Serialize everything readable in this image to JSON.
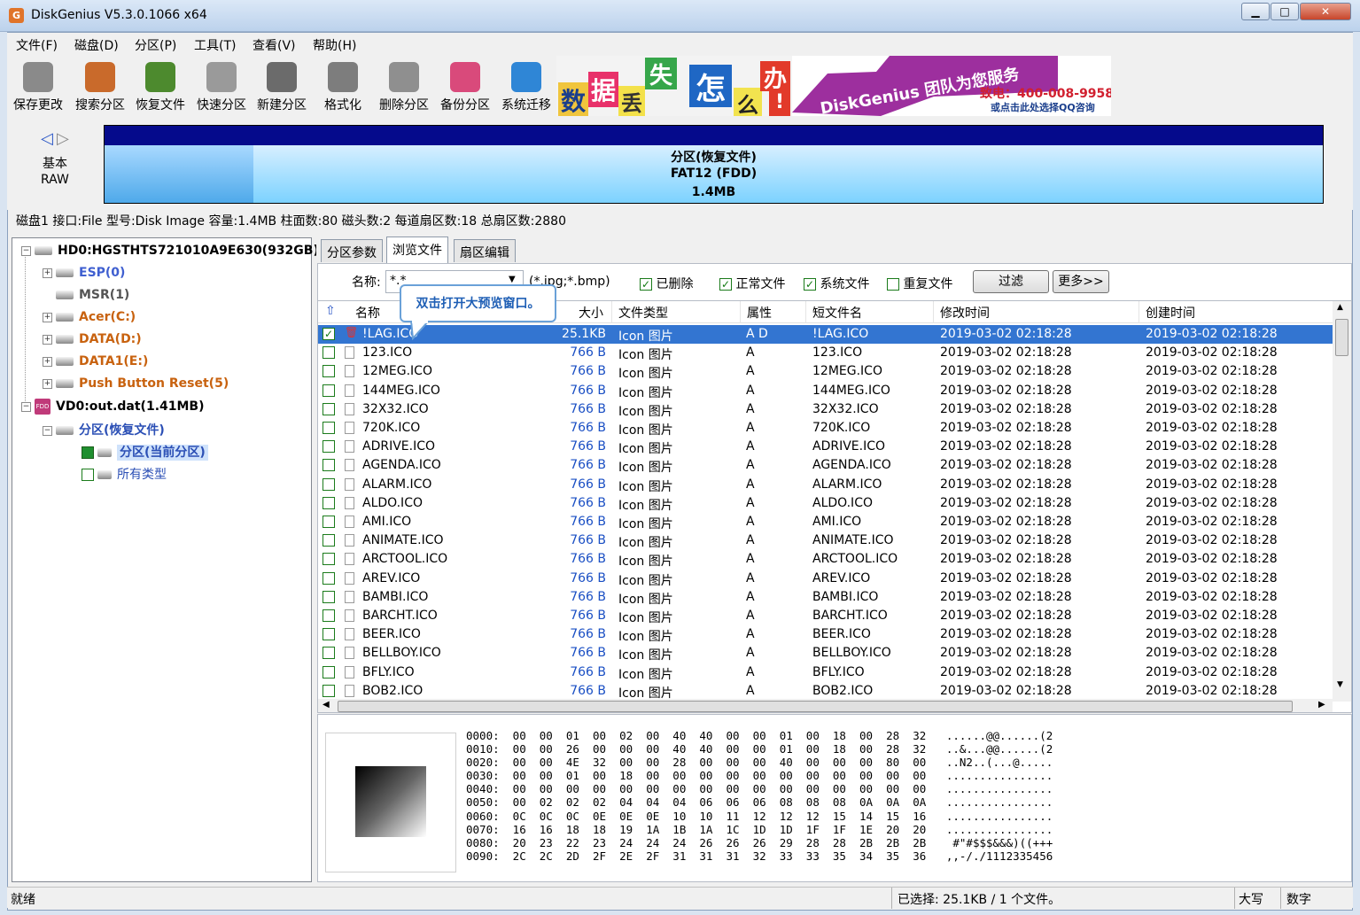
{
  "window": {
    "title": "DiskGenius V5.3.0.1066 x64",
    "icon_text": "G"
  },
  "menu": [
    "文件(F)",
    "磁盘(D)",
    "分区(P)",
    "工具(T)",
    "查看(V)",
    "帮助(H)"
  ],
  "toolbar": [
    {
      "label": "保存更改",
      "icon": "save-changes-icon",
      "color": "#8a8a8a"
    },
    {
      "label": "搜索分区",
      "icon": "search-partition-icon",
      "color": "#c96a2b"
    },
    {
      "label": "恢复文件",
      "icon": "recover-files-icon",
      "color": "#4d8a2e"
    },
    {
      "label": "快速分区",
      "icon": "quick-partition-icon",
      "color": "#9a9a9a"
    },
    {
      "label": "新建分区",
      "icon": "new-partition-icon",
      "color": "#6b6b6b"
    },
    {
      "label": "格式化",
      "icon": "format-icon",
      "color": "#7d7d7d"
    },
    {
      "label": "删除分区",
      "icon": "delete-partition-icon",
      "color": "#8f8f8f"
    },
    {
      "label": "备份分区",
      "icon": "backup-partition-icon",
      "color": "#d94a7b"
    },
    {
      "label": "系统迁移",
      "icon": "system-migration-icon",
      "color": "#2f86d6"
    }
  ],
  "banner": {
    "chars": [
      "数",
      "据",
      "丢",
      "失",
      "怎",
      "么",
      "办",
      "!"
    ],
    "slogan": "DiskGenius 团队为您服务",
    "phone": "致电：400-008-9958",
    "qq": "或点击此处选择QQ咨询"
  },
  "diskmap": {
    "disk_label": "基本",
    "disk_type": "RAW",
    "partition_name": "分区(恢复文件)",
    "partition_fs": "FAT12 (FDD)",
    "partition_size": "1.4MB"
  },
  "diskinfo": "磁盘1 接口:File  型号:Disk Image  容量:1.4MB  柱面数:80  磁头数:2  每道扇区数:18  总扇区数:2880",
  "tree": {
    "hd0": "HD0:HGSTHTS721010A9E630(932GB)",
    "hd0_parts": [
      {
        "label": "ESP(0)",
        "color": "#3f5fd0"
      },
      {
        "label": "MSR(1)",
        "color": "#555555"
      },
      {
        "label": "Acer(C:)",
        "color": "#c8620f"
      },
      {
        "label": "DATA(D:)",
        "color": "#c8620f"
      },
      {
        "label": "DATA1(E:)",
        "color": "#c8620f"
      },
      {
        "label": "Push Button Reset(5)",
        "color": "#c8620f"
      }
    ],
    "vd0": "VD0:out.dat(1.41MB)",
    "vd0_part": "分区(恢复文件)",
    "current_partition": "分区(当前分区)",
    "all_types": "所有类型"
  },
  "tabs": [
    "分区参数",
    "浏览文件",
    "扇区编辑"
  ],
  "filter": {
    "name_label": "名称:",
    "name_value": "*.*",
    "name_hint": "(*.jpg;*.bmp)",
    "checks": [
      {
        "label": "已删除",
        "checked": true
      },
      {
        "label": "正常文件",
        "checked": true
      },
      {
        "label": "系统文件",
        "checked": true
      },
      {
        "label": "重复文件",
        "checked": false
      }
    ],
    "filter_button": "过滤",
    "more_button": "更多>>"
  },
  "tooltip": "双击打开大预览窗口。",
  "columns": [
    "名称",
    "大小",
    "文件类型",
    "属性",
    "短文件名",
    "修改时间",
    "创建时间"
  ],
  "files": [
    {
      "name": "!LAG.ICO",
      "size": "25.1KB",
      "type": "Icon 图片",
      "attr": "A D",
      "short": "!LAG.ICO",
      "mtime": "2019-03-02 02:18:28",
      "ctime": "2019-03-02 02:18:28",
      "checked": true,
      "deleted": true
    },
    {
      "name": "123.ICO",
      "size": "766 B",
      "type": "Icon 图片",
      "attr": "A",
      "short": "123.ICO",
      "mtime": "2019-03-02 02:18:28",
      "ctime": "2019-03-02 02:18:28"
    },
    {
      "name": "12MEG.ICO",
      "size": "766 B",
      "type": "Icon 图片",
      "attr": "A",
      "short": "12MEG.ICO",
      "mtime": "2019-03-02 02:18:28",
      "ctime": "2019-03-02 02:18:28"
    },
    {
      "name": "144MEG.ICO",
      "size": "766 B",
      "type": "Icon 图片",
      "attr": "A",
      "short": "144MEG.ICO",
      "mtime": "2019-03-02 02:18:28",
      "ctime": "2019-03-02 02:18:28"
    },
    {
      "name": "32X32.ICO",
      "size": "766 B",
      "type": "Icon 图片",
      "attr": "A",
      "short": "32X32.ICO",
      "mtime": "2019-03-02 02:18:28",
      "ctime": "2019-03-02 02:18:28"
    },
    {
      "name": "720K.ICO",
      "size": "766 B",
      "type": "Icon 图片",
      "attr": "A",
      "short": "720K.ICO",
      "mtime": "2019-03-02 02:18:28",
      "ctime": "2019-03-02 02:18:28"
    },
    {
      "name": "ADRIVE.ICO",
      "size": "766 B",
      "type": "Icon 图片",
      "attr": "A",
      "short": "ADRIVE.ICO",
      "mtime": "2019-03-02 02:18:28",
      "ctime": "2019-03-02 02:18:28"
    },
    {
      "name": "AGENDA.ICO",
      "size": "766 B",
      "type": "Icon 图片",
      "attr": "A",
      "short": "AGENDA.ICO",
      "mtime": "2019-03-02 02:18:28",
      "ctime": "2019-03-02 02:18:28"
    },
    {
      "name": "ALARM.ICO",
      "size": "766 B",
      "type": "Icon 图片",
      "attr": "A",
      "short": "ALARM.ICO",
      "mtime": "2019-03-02 02:18:28",
      "ctime": "2019-03-02 02:18:28"
    },
    {
      "name": "ALDO.ICO",
      "size": "766 B",
      "type": "Icon 图片",
      "attr": "A",
      "short": "ALDO.ICO",
      "mtime": "2019-03-02 02:18:28",
      "ctime": "2019-03-02 02:18:28"
    },
    {
      "name": "AMI.ICO",
      "size": "766 B",
      "type": "Icon 图片",
      "attr": "A",
      "short": "AMI.ICO",
      "mtime": "2019-03-02 02:18:28",
      "ctime": "2019-03-02 02:18:28"
    },
    {
      "name": "ANIMATE.ICO",
      "size": "766 B",
      "type": "Icon 图片",
      "attr": "A",
      "short": "ANIMATE.ICO",
      "mtime": "2019-03-02 02:18:28",
      "ctime": "2019-03-02 02:18:28"
    },
    {
      "name": "ARCTOOL.ICO",
      "size": "766 B",
      "type": "Icon 图片",
      "attr": "A",
      "short": "ARCTOOL.ICO",
      "mtime": "2019-03-02 02:18:28",
      "ctime": "2019-03-02 02:18:28"
    },
    {
      "name": "AREV.ICO",
      "size": "766 B",
      "type": "Icon 图片",
      "attr": "A",
      "short": "AREV.ICO",
      "mtime": "2019-03-02 02:18:28",
      "ctime": "2019-03-02 02:18:28"
    },
    {
      "name": "BAMBI.ICO",
      "size": "766 B",
      "type": "Icon 图片",
      "attr": "A",
      "short": "BAMBI.ICO",
      "mtime": "2019-03-02 02:18:28",
      "ctime": "2019-03-02 02:18:28"
    },
    {
      "name": "BARCHT.ICO",
      "size": "766 B",
      "type": "Icon 图片",
      "attr": "A",
      "short": "BARCHT.ICO",
      "mtime": "2019-03-02 02:18:28",
      "ctime": "2019-03-02 02:18:28"
    },
    {
      "name": "BEER.ICO",
      "size": "766 B",
      "type": "Icon 图片",
      "attr": "A",
      "short": "BEER.ICO",
      "mtime": "2019-03-02 02:18:28",
      "ctime": "2019-03-02 02:18:28"
    },
    {
      "name": "BELLBOY.ICO",
      "size": "766 B",
      "type": "Icon 图片",
      "attr": "A",
      "short": "BELLBOY.ICO",
      "mtime": "2019-03-02 02:18:28",
      "ctime": "2019-03-02 02:18:28"
    },
    {
      "name": "BFLY.ICO",
      "size": "766 B",
      "type": "Icon 图片",
      "attr": "A",
      "short": "BFLY.ICO",
      "mtime": "2019-03-02 02:18:28",
      "ctime": "2019-03-02 02:18:28"
    },
    {
      "name": "BOB2.ICO",
      "size": "766 B",
      "type": "Icon 图片",
      "attr": "A",
      "short": "BOB2.ICO",
      "mtime": "2019-03-02 02:18:28",
      "ctime": "2019-03-02 02:18:28"
    }
  ],
  "hex": [
    "0000:  00  00  01  00  02  00  40  40  00  00  01  00  18  00  28  32   ......@@......(2",
    "0010:  00  00  26  00  00  00  40  40  00  00  01  00  18  00  28  32   ..&...@@......(2",
    "0020:  00  00  4E  32  00  00  28  00  00  00  40  00  00  00  80  00   ..N2..(...@.....",
    "0030:  00  00  01  00  18  00  00  00  00  00  00  00  00  00  00  00   ................",
    "0040:  00  00  00  00  00  00  00  00  00  00  00  00  00  00  00  00   ................",
    "0050:  00  02  02  02  04  04  04  06  06  06  08  08  08  0A  0A  0A   ................",
    "0060:  0C  0C  0C  0E  0E  0E  10  10  11  12  12  12  15  14  15  16   ................",
    "0070:  16  16  18  18  19  1A  1B  1A  1C  1D  1D  1F  1F  1E  20  20   ................",
    "0080:  20  23  22  23  24  24  24  26  26  26  29  28  28  2B  2B  2B    #\"#$$$&&&)((+++",
    "0090:  2C  2C  2D  2F  2E  2F  31  31  31  32  33  33  35  34  35  36   ,,-/./1112335456"
  ],
  "status": {
    "left": "就绪",
    "selection": "已选择: 25.1KB / 1 个文件。",
    "caps": "大写",
    "num": "数字"
  }
}
